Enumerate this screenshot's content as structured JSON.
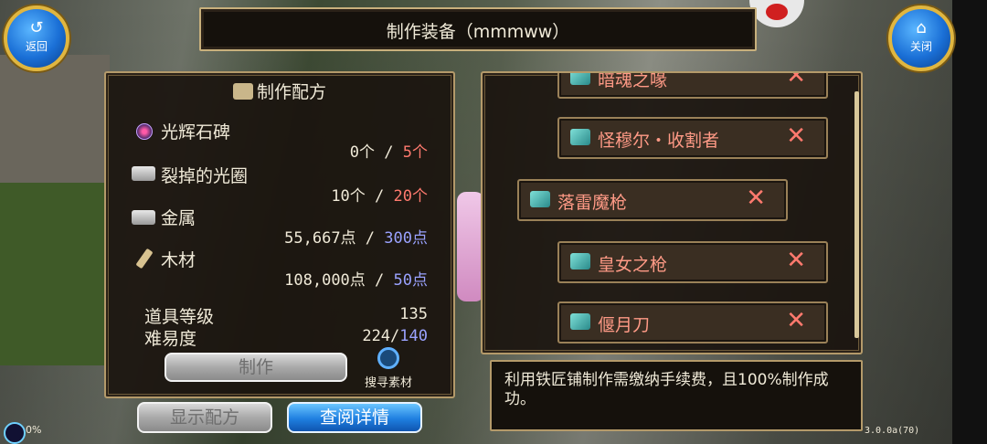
{
  "window": {
    "title": "制作装备（mmmww）"
  },
  "nav": {
    "back_label": "返回",
    "close_label": "关闭"
  },
  "recipe": {
    "title": "制作配方",
    "materials": [
      {
        "name": "光辉石碑",
        "have": "0个",
        "sep": " / ",
        "need": "5个",
        "need_color": "#ff7a6e",
        "icon": "orb-icon"
      },
      {
        "name": "裂掉的光圈",
        "have": "10个",
        "sep": " / ",
        "need": "20个",
        "need_color": "#ff7a6e",
        "icon": "anvil-icon"
      },
      {
        "name": "金属",
        "have": "55,667点",
        "sep": " / ",
        "need": "300点",
        "need_color": "#9aa2ff",
        "icon": "metal-icon"
      },
      {
        "name": "木材",
        "have": "108,000点",
        "sep": " / ",
        "need": "50点",
        "need_color": "#9aa2ff",
        "icon": "wood-icon"
      }
    ],
    "item_level_label": "道具等级",
    "item_level_value": "135",
    "difficulty_label": "难易度",
    "difficulty_have": "224/",
    "difficulty_need": "140",
    "craft_button": "制作",
    "search_label": "搜寻素材"
  },
  "buttons": {
    "show_recipe": "显示配方",
    "view_details": "查阅详情"
  },
  "list": {
    "items": [
      {
        "name": "暗魂之喙"
      },
      {
        "name": "怪穆尔・收割者"
      },
      {
        "name": "落雷魔枪"
      },
      {
        "name": "皇女之枪"
      },
      {
        "name": "偃月刀"
      }
    ]
  },
  "info": {
    "text": "利用铁匠铺制作需缴纳手续费，且100%制作成功。"
  },
  "status": {
    "percent": "0%",
    "version": "3.0.0a(70)"
  },
  "colors": {
    "frame": "#b49a6a",
    "panel": "#1a140e",
    "name_red": "#ff9a86",
    "blue_btn": "#1f7fe0"
  }
}
